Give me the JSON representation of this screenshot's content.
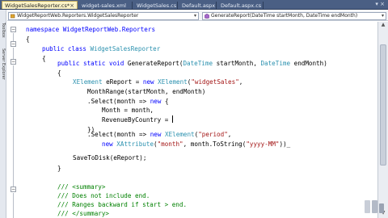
{
  "tabs": [
    {
      "label": "WidgetSalesReporter.cs*",
      "active": true
    },
    {
      "label": "widget-sales.xml",
      "active": false
    },
    {
      "label": "WidgetSales.cs",
      "active": false
    },
    {
      "label": "Default.aspx",
      "active": false
    },
    {
      "label": "Default.aspx.cs",
      "active": false
    }
  ],
  "left_panel": {
    "toolbox": "Toolbox",
    "server_explorer": "Server Explorer"
  },
  "nav": {
    "type_combo": "WidgetReportWeb.Reporters.WidgetSalesReporter",
    "member_combo": "GenerateReport(DateTime startMonth, DateTime endMonth)"
  },
  "code": {
    "l1": "namespace WidgetReportWeb.Reporters",
    "l2": "{",
    "l3_kw": "public class ",
    "l3_type": "WidgetSalesReporter",
    "l4": "{",
    "l5_kw": "public static void ",
    "l5_name": "GenerateReport(",
    "l5_t1": "DateTime",
    "l5_p1": " startMonth, ",
    "l5_t2": "DateTime",
    "l5_p2": " endMonth)",
    "l6": "{",
    "l7_t": "XElement",
    "l7_a": " eReport = ",
    "l7_kw": "new ",
    "l7_t2": "XElement",
    "l7_b": "(",
    "l7_s": "\"widgetSales\"",
    "l7_c": ",",
    "l8": "MonthRange(startMonth, endMonth)",
    "l9_a": ".Select(month => ",
    "l9_kw": "new",
    "l9_b": " {",
    "l10": "Month = month,",
    "l11": "RevenueByCountry = ",
    "l12": "})",
    "l13_a": ".Select(month => ",
    "l13_kw": "new ",
    "l13_t": "XElement",
    "l13_b": "(",
    "l13_s": "\"period\"",
    "l13_c": ",",
    "l14_kw": "new ",
    "l14_t": "XAttribute",
    "l14_b": "(",
    "l14_s1": "\"month\"",
    "l14_c": ", month.ToString(",
    "l14_s2": "\"yyyy-MM\"",
    "l14_d": "))_",
    "l15": "SaveToDisk(eReport);",
    "l16": "}",
    "l17": "/// <summary>",
    "l18": "/// Does not include end.",
    "l19": "/// Ranges backward if start > end.",
    "l20": "/// </summary>"
  },
  "colors": {
    "keyword": "#0000ff",
    "type": "#2b91af",
    "string": "#a31515",
    "comment": "#008000",
    "tab_active": "#fbf3c6",
    "tabbar": "#4a5f84"
  },
  "icons": {
    "tab_close": "close-icon",
    "collapse": "collapse-minus-icon"
  }
}
